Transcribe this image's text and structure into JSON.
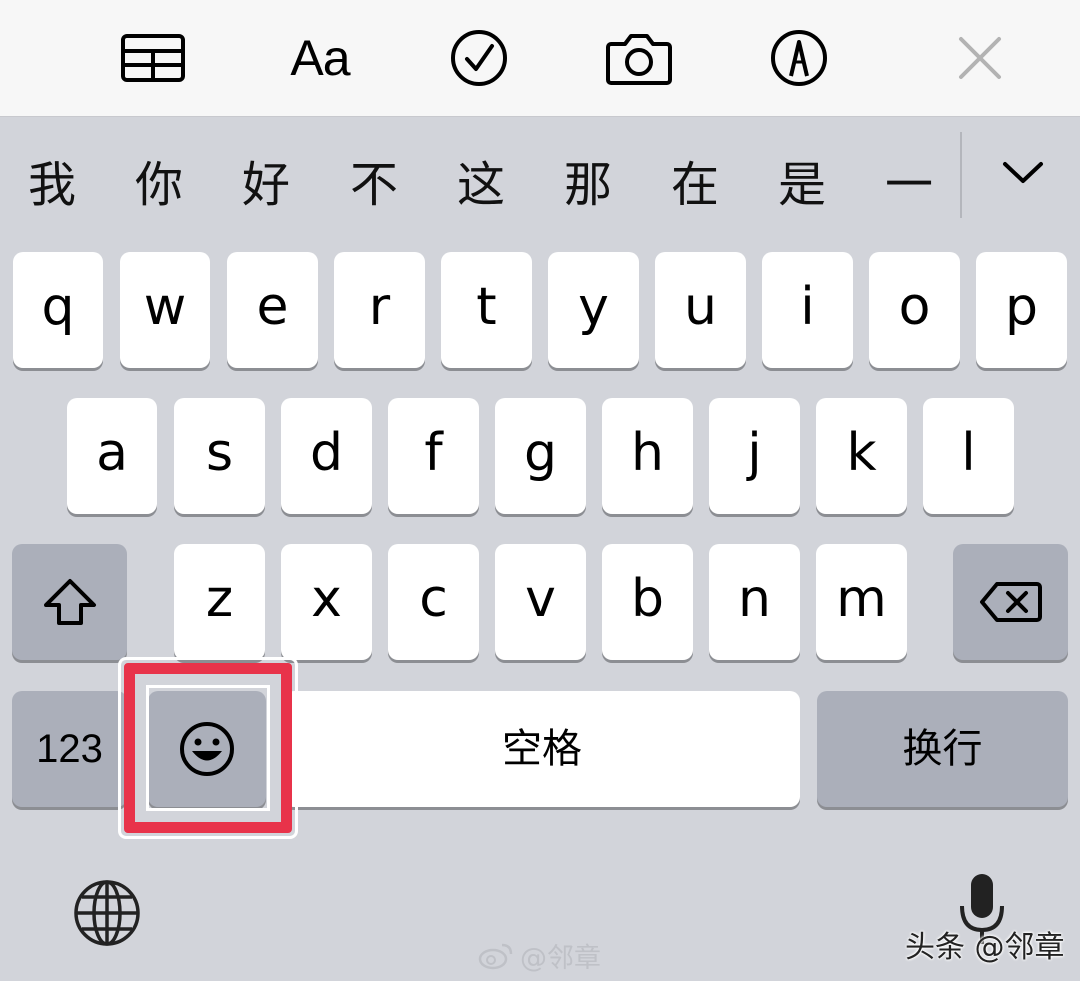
{
  "toolbar": {
    "items": [
      {
        "name": "table",
        "icon": "table-icon"
      },
      {
        "name": "format",
        "label": "Aa"
      },
      {
        "name": "checklist",
        "icon": "checkmark-circle-icon"
      },
      {
        "name": "camera",
        "icon": "camera-icon"
      },
      {
        "name": "markup",
        "icon": "pen-tip-icon"
      },
      {
        "name": "close",
        "icon": "close-icon"
      }
    ]
  },
  "candidates": {
    "words": [
      "我",
      "你",
      "好",
      "不",
      "这",
      "那",
      "在",
      "是",
      "一"
    ],
    "expand_icon": "chevron-down-icon"
  },
  "keyboard": {
    "row1": [
      "q",
      "w",
      "e",
      "r",
      "t",
      "y",
      "u",
      "i",
      "o",
      "p"
    ],
    "row2": [
      "a",
      "s",
      "d",
      "f",
      "g",
      "h",
      "j",
      "k",
      "l"
    ],
    "row3": [
      "z",
      "x",
      "c",
      "v",
      "b",
      "n",
      "m"
    ],
    "shift_icon": "shift-arrow-icon",
    "delete_icon": "backspace-icon",
    "numbers_label": "123",
    "emoji_icon": "smiley-face-icon",
    "space_label": "空格",
    "return_label": "换行",
    "globe_icon": "globe-icon",
    "mic_icon": "microphone-icon"
  },
  "highlight": {
    "color": "#e8334a"
  },
  "watermarks": {
    "weibo": "@邻章",
    "toutiao": "头条 @邻章"
  },
  "colors": {
    "keyboard_bg": "#d2d4da",
    "key_bg": "#ffffff",
    "dark_key_bg": "#abafba",
    "toolbar_bg": "#f7f7f7"
  }
}
